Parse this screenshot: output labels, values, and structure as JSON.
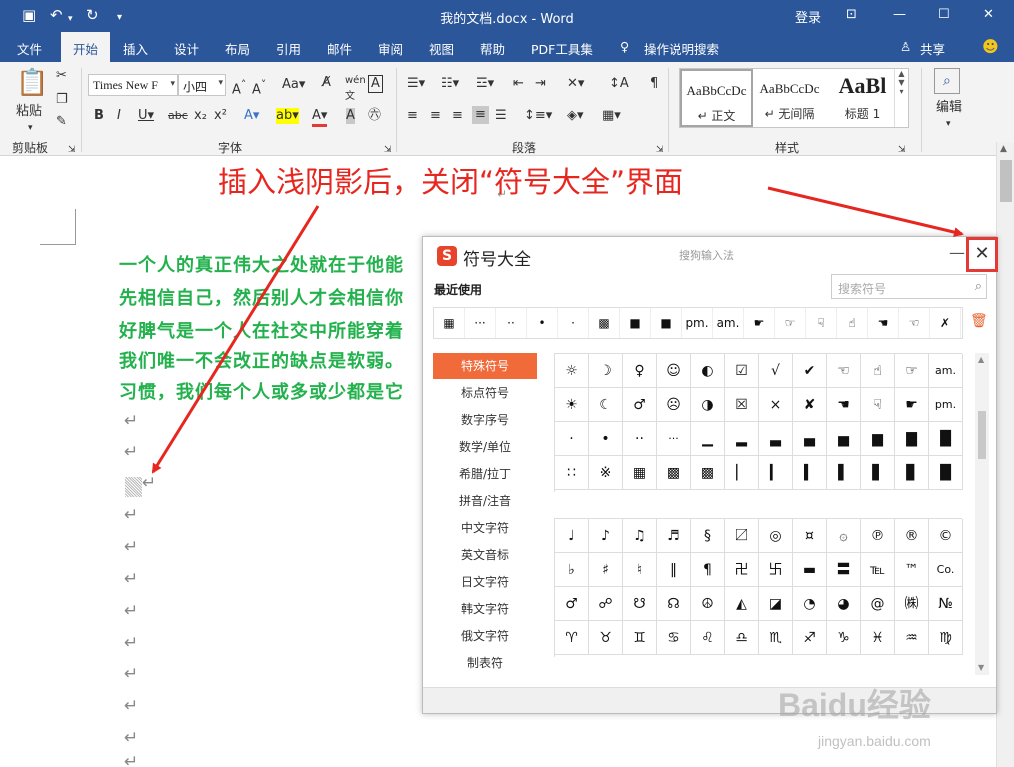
{
  "titlebar": {
    "title": "我的文档.docx  -  Word",
    "login": "登录",
    "save_icon": "save-icon",
    "undo_icon": "undo-icon",
    "redo_icon": "redo-icon"
  },
  "tabs": [
    "文件",
    "开始",
    "插入",
    "设计",
    "布局",
    "引用",
    "邮件",
    "审阅",
    "视图",
    "帮助",
    "PDF工具集",
    "操作说明搜索"
  ],
  "share": "共享",
  "ribbon": {
    "clipboard": {
      "paste": "粘贴",
      "label": "剪贴板"
    },
    "font": {
      "name": "Times New F",
      "size": "小四",
      "label": "字体"
    },
    "paragraph": {
      "label": "段落"
    },
    "styles": {
      "label": "样式",
      "items": [
        {
          "preview": "AaBbCcDc",
          "name": "↵ 正文"
        },
        {
          "preview": "AaBbCcDc",
          "name": "↵ 无间隔"
        },
        {
          "preview": "AaBl",
          "name": "标题 1"
        }
      ]
    },
    "editing": {
      "label": "编辑"
    }
  },
  "document": {
    "lines": [
      "一个人的真正伟大之处就在于他能",
      "先相信自己，然后别人才会相信你",
      "好脾气是一个人在社交中所能穿着",
      "我们唯一不会改正的缺点是软弱。",
      "习惯，我们每个人或多或少都是它"
    ],
    "para_mark": "↵"
  },
  "dialog": {
    "title": "符号大全",
    "subtitle": "搜狗输入法",
    "minimize": "—",
    "close": "✕",
    "recent_label": "最近使用",
    "search_placeholder": "搜索符号",
    "recent": [
      "▦",
      "···",
      "··",
      "•",
      "·",
      "▩",
      "■",
      "■",
      "pm.",
      "am.",
      "☛",
      "☞",
      "☟",
      "☝",
      "☚",
      "☜",
      "✗"
    ],
    "categories": [
      "特殊符号",
      "标点符号",
      "数字序号",
      "数学/单位",
      "希腊/拉丁",
      "拼音/注音",
      "中文字符",
      "英文音标",
      "日文字符",
      "韩文字符",
      "俄文字符",
      "制表符"
    ],
    "active_category": "特殊符号",
    "grid1": [
      [
        "☼",
        "☽",
        "♀",
        "☺",
        "◐",
        "☑",
        "√",
        "✔",
        "☜",
        "☝",
        "☞",
        "am."
      ],
      [
        "☀",
        "☾",
        "♂",
        "☹",
        "◑",
        "☒",
        "×",
        "✘",
        "☚",
        "☟",
        "☛",
        "pm."
      ],
      [
        "·",
        "•",
        "··",
        "···",
        "▁",
        "▂",
        "▃",
        "▄",
        "▅",
        "▆",
        "▇",
        "█"
      ],
      [
        "∷",
        "※",
        "▦",
        "▩",
        "▩",
        "▏",
        "▎",
        "▍",
        "▌",
        "▋",
        "▊",
        "█"
      ]
    ],
    "grid2": [
      [
        "♩",
        "♪",
        "♫",
        "♬",
        "§",
        "〼",
        "◎",
        "¤",
        "۞",
        "℗",
        "®",
        "©"
      ],
      [
        "♭",
        "♯",
        "♮",
        "‖",
        "¶",
        "卍",
        "卐",
        "▬",
        "〓",
        "℡",
        "™",
        "Co."
      ],
      [
        "♂",
        "☍",
        "☋",
        "☊",
        "☮",
        "◭",
        "◪",
        "◔",
        "◕",
        "@",
        "㈱",
        "№"
      ],
      [
        "♈",
        "♉",
        "♊",
        "♋",
        "♌",
        "♎",
        "♏",
        "♐",
        "♑",
        "♓",
        "♒",
        "♍"
      ]
    ]
  },
  "annotation": "插入浅阴影后，关闭“符号大全”界面",
  "watermark": {
    "brand": "Baidu经验",
    "url": "jingyan.baidu.com"
  }
}
